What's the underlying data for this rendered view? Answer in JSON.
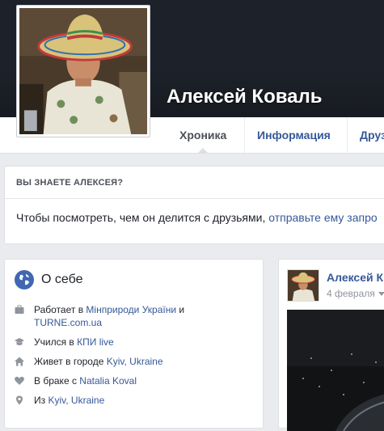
{
  "profile": {
    "name": "Алексей Коваль"
  },
  "tabs": [
    {
      "label": "Хроника"
    },
    {
      "label": "Информация"
    },
    {
      "label": "Друз"
    }
  ],
  "know_card": {
    "title": "ВЫ ЗНАЕТЕ АЛЕКСЕЯ?",
    "text": "Чтобы посмотреть, чем он делится с друзьями, ",
    "link": "отправьте ему запро"
  },
  "about": {
    "title": "О себе",
    "icon": "globe-icon",
    "items": [
      {
        "icon": "briefcase-icon",
        "prefix": "Работает в ",
        "link": "Мінприроди України",
        "suffix": " и ",
        "link2": "TURNE.com.ua"
      },
      {
        "icon": "graduation-cap-icon",
        "prefix": "Учился в ",
        "link": "КПИ live",
        "suffix": "",
        "link2": ""
      },
      {
        "icon": "home-icon",
        "prefix": "Живет в городе ",
        "link": "Kyiv, Ukraine",
        "suffix": "",
        "link2": ""
      },
      {
        "icon": "heart-icon",
        "prefix": "В браке с ",
        "link": "Natalia Koval",
        "suffix": "",
        "link2": ""
      },
      {
        "icon": "map-pin-icon",
        "prefix": "Из ",
        "link": "Kyiv, Ukraine",
        "suffix": "",
        "link2": ""
      }
    ]
  },
  "post": {
    "author": "Алексей К",
    "date": "4 февраля"
  },
  "colors": {
    "link": "#365899",
    "cover": "#1d2129",
    "background": "#e9ebee"
  }
}
